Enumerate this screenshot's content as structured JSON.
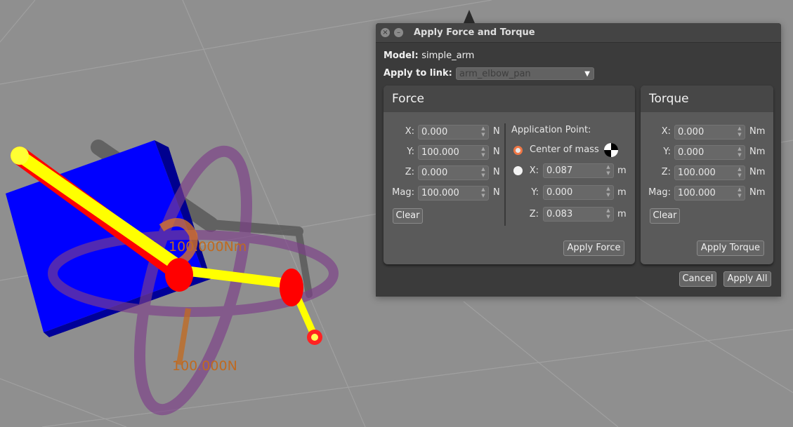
{
  "dialog": {
    "title": "Apply Force and Torque",
    "model_label": "Model:",
    "model_value": "simple_arm",
    "link_label": "Apply to link:",
    "link_value": "arm_elbow_pan"
  },
  "force": {
    "heading": "Force",
    "x_label": "X:",
    "x_value": "0.000",
    "y_label": "Y:",
    "y_value": "100.000",
    "z_label": "Z:",
    "z_value": "0.000",
    "mag_label": "Mag:",
    "mag_value": "100.000",
    "unit": "N",
    "clear_label": "Clear",
    "apply_label": "Apply Force",
    "application_point": {
      "heading": "Application Point:",
      "center_of_mass_label": "Center of mass",
      "center_of_mass_selected": true,
      "x_label": "X:",
      "x_value": "0.087",
      "y_label": "Y:",
      "y_value": "0.000",
      "z_label": "Z:",
      "z_value": "0.083",
      "unit": "m"
    }
  },
  "torque": {
    "heading": "Torque",
    "x_label": "X:",
    "x_value": "0.000",
    "y_label": "Y:",
    "y_value": "0.000",
    "z_label": "Z:",
    "z_value": "100.000",
    "mag_label": "Mag:",
    "mag_value": "100.000",
    "unit": "Nm",
    "clear_label": "Clear",
    "apply_label": "Apply Torque"
  },
  "footer": {
    "cancel_label": "Cancel",
    "apply_all_label": "Apply All"
  },
  "scene": {
    "torque_label": "100.000Nm",
    "force_label": "100.000N"
  },
  "colors": {
    "radio_accent": "#f07746",
    "box": "#0000ff",
    "arm": "#ffff00",
    "joint": "#ff0000",
    "torque_ring": "#7d3f8a",
    "force_arrow": "#c46a1e"
  }
}
